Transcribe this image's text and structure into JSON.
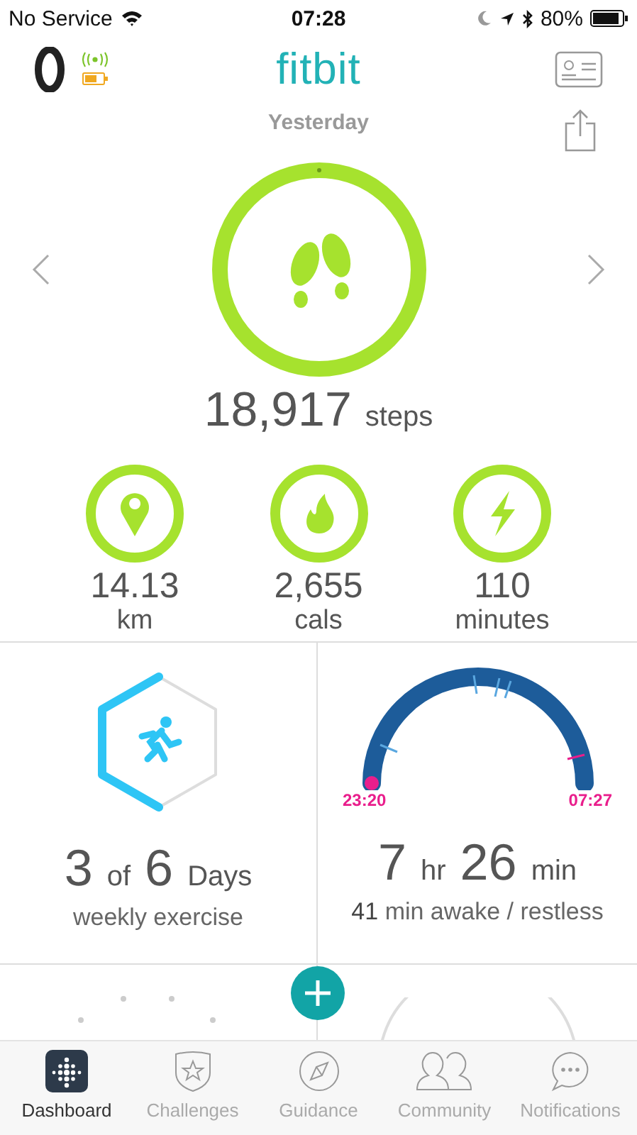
{
  "status_bar": {
    "carrier": "No Service",
    "time": "07:28",
    "battery": "80%"
  },
  "header": {
    "logo": "fitbit"
  },
  "date_label": "Yesterday",
  "steps": {
    "value": "18,917",
    "unit": "steps"
  },
  "stats": [
    {
      "value": "14.13",
      "unit": "km",
      "kind": "distance"
    },
    {
      "value": "2,655",
      "unit": "cals",
      "kind": "calories"
    },
    {
      "value": "110",
      "unit": "minutes",
      "kind": "active"
    }
  ],
  "exercise": {
    "count": "3",
    "of": "of",
    "total": "6",
    "unit": "Days",
    "label": "weekly exercise"
  },
  "sleep": {
    "start": "23:20",
    "end": "07:27",
    "hours": "7",
    "hours_unit": "hr",
    "minutes": "26",
    "minutes_unit": "min",
    "awake": "41",
    "awake_label": "min awake / restless"
  },
  "tabs": [
    {
      "label": "Dashboard",
      "selected": true,
      "kind": "dashboard"
    },
    {
      "label": "Challenges",
      "selected": false,
      "kind": "challenges"
    },
    {
      "label": "Guidance",
      "selected": false,
      "kind": "guidance"
    },
    {
      "label": "Community",
      "selected": false,
      "kind": "community"
    },
    {
      "label": "Notifications",
      "selected": false,
      "kind": "notifications"
    }
  ]
}
